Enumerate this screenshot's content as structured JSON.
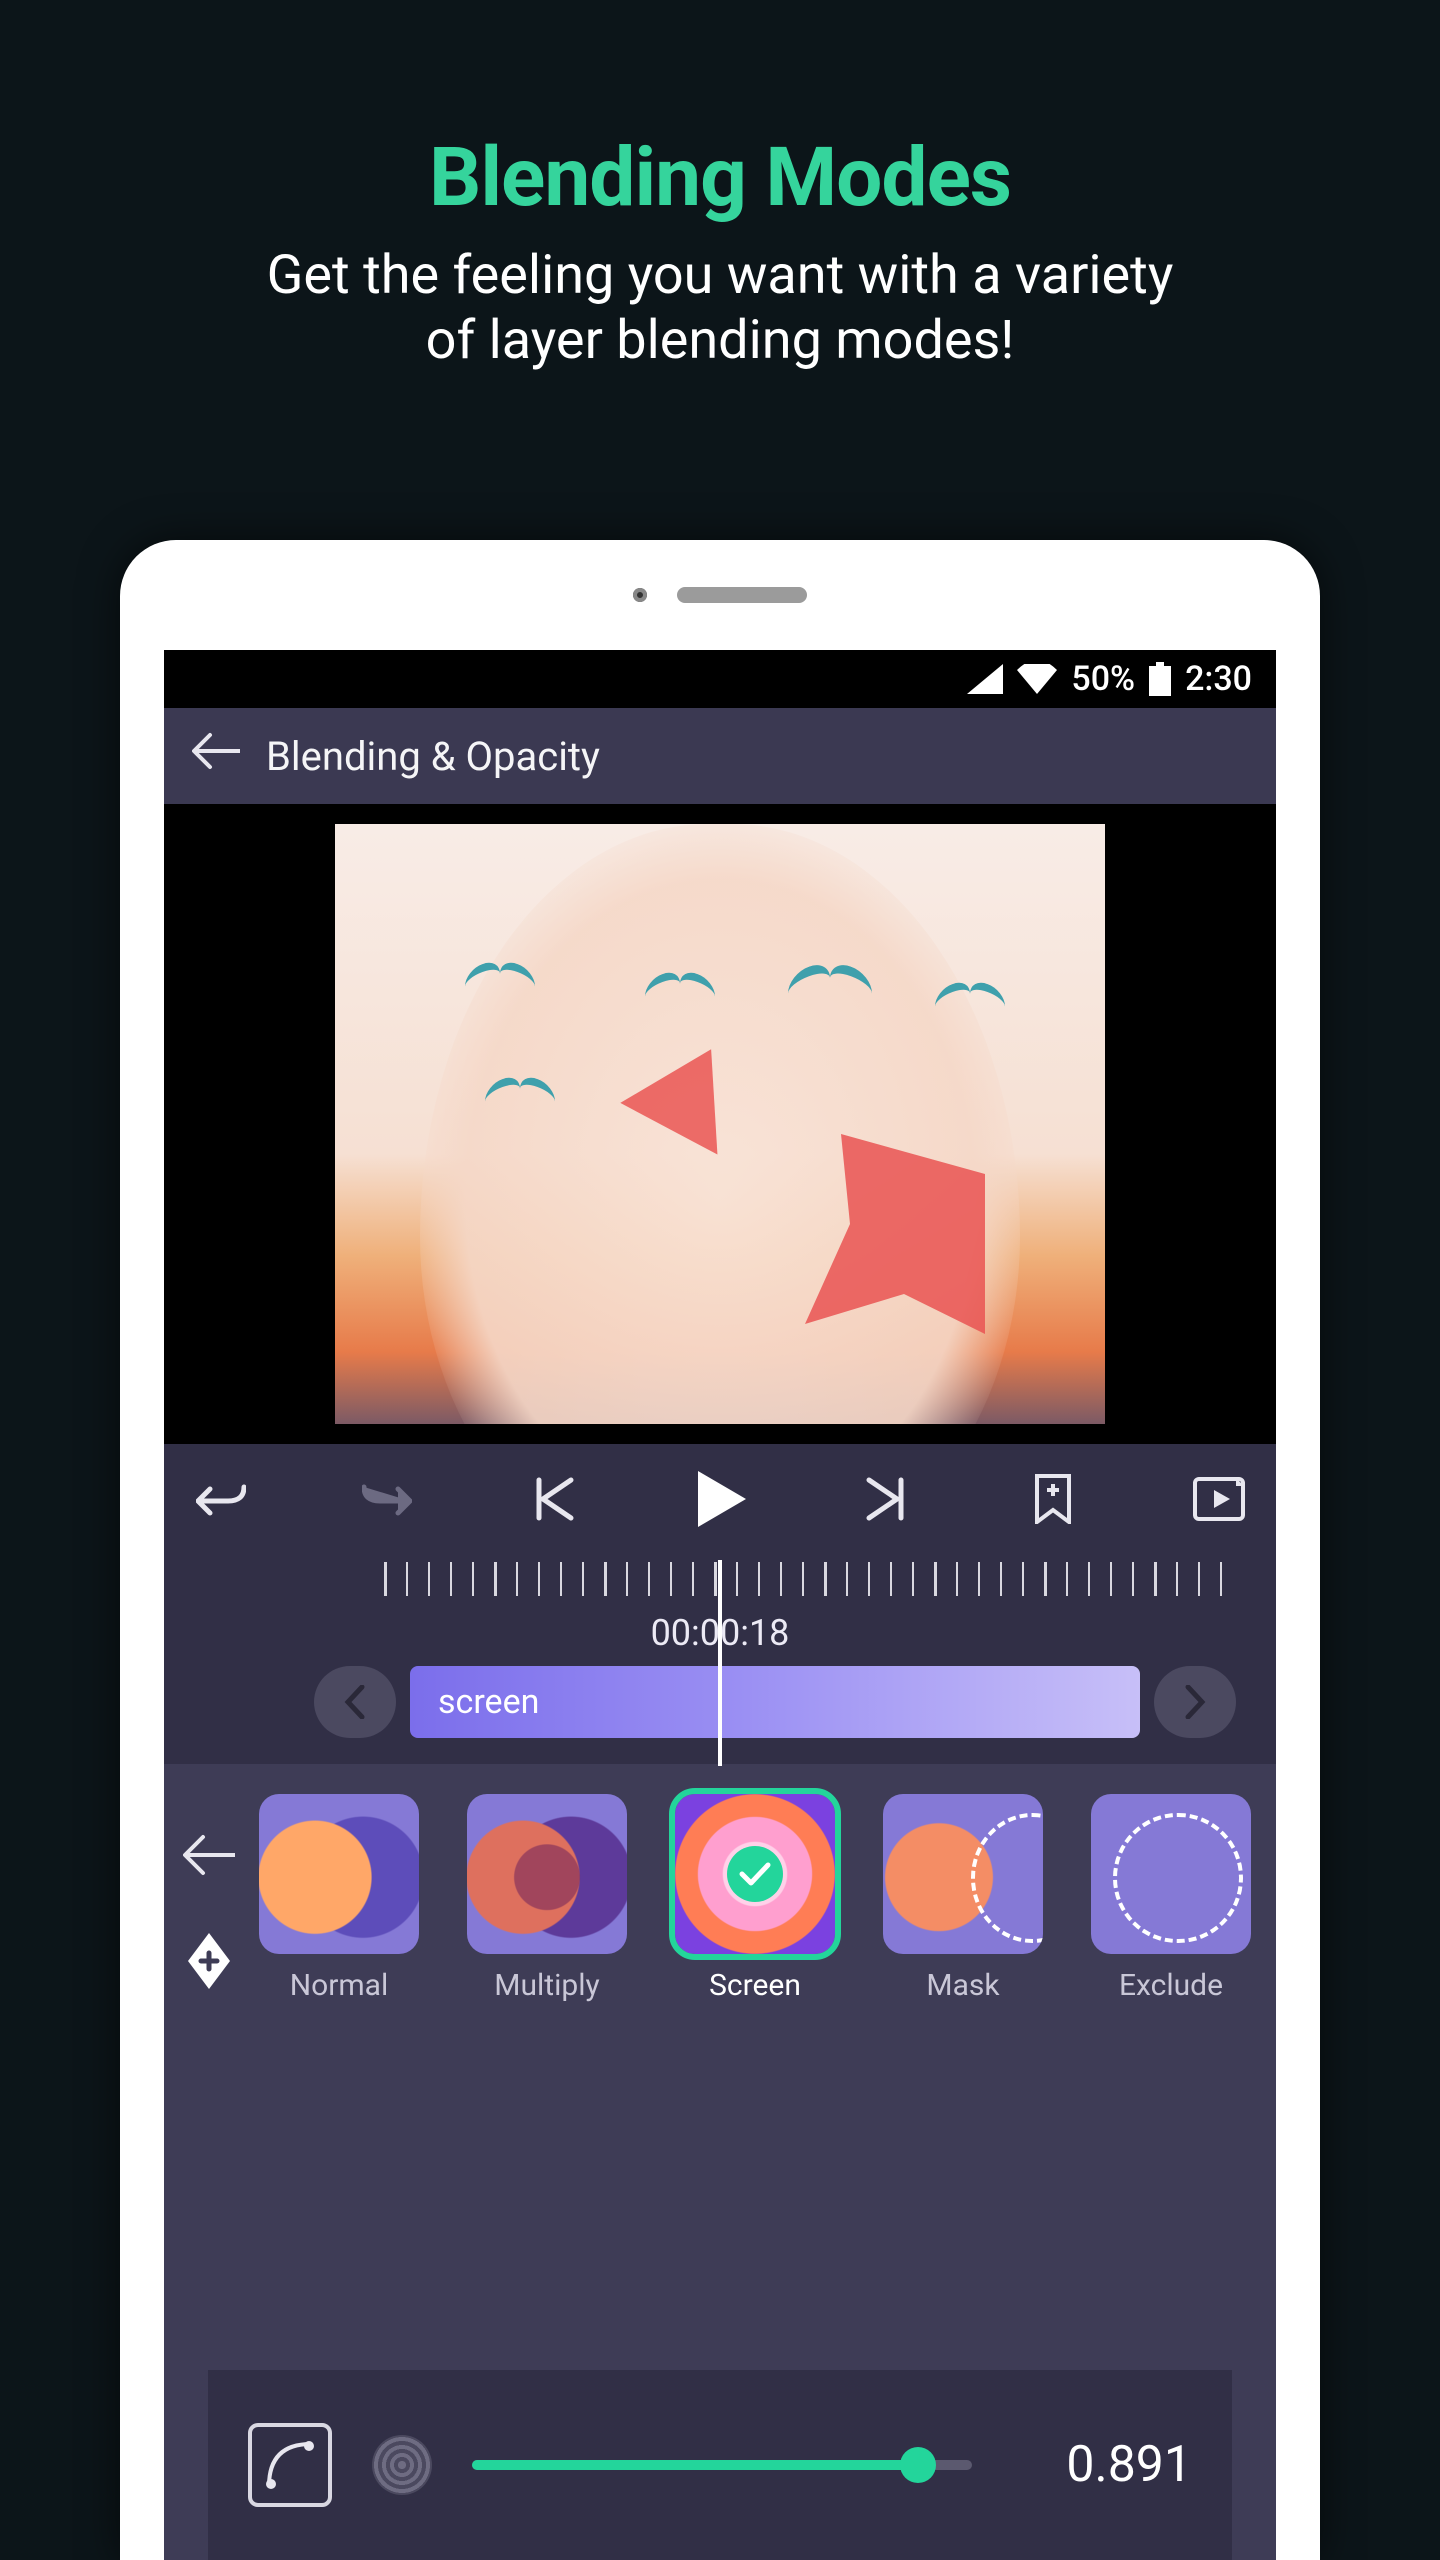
{
  "hero": {
    "title": "Blending Modes",
    "subtitle_line1": "Get the feeling you want with a variety",
    "subtitle_line2": "of layer blending modes!"
  },
  "status": {
    "battery_pct": "50%",
    "clock": "2:30"
  },
  "appbar": {
    "title": "Blending & Opacity"
  },
  "timeline": {
    "timecode": "00:00:18",
    "clip_label": "screen"
  },
  "modes": {
    "items": [
      {
        "label": "Normal"
      },
      {
        "label": "Multiply"
      },
      {
        "label": "Screen"
      },
      {
        "label": "Mask"
      },
      {
        "label": "Exclude"
      }
    ],
    "selected_index": 2
  },
  "opacity": {
    "value": 0.891,
    "display": "0.891"
  },
  "colors": {
    "accent": "#23d59b",
    "clip_gradient_from": "#7b6eeb",
    "clip_gradient_to": "#c7bff8"
  }
}
